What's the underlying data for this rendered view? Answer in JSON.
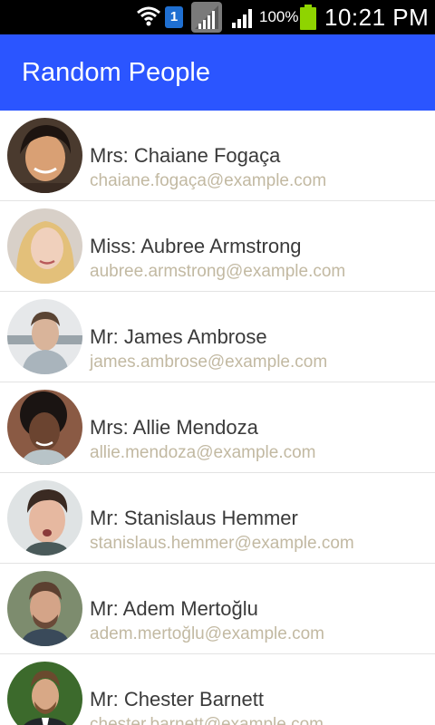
{
  "status_bar": {
    "sim_slot": "1",
    "battery_percent": "100%",
    "time": "10:21 PM",
    "icons": [
      "wifi-icon",
      "sim-icon",
      "signal-empty-icon",
      "signal-icon",
      "battery-icon"
    ],
    "battery_color": "#8fd400"
  },
  "app_bar": {
    "title": "Random People",
    "background_color": "#2b55ff"
  },
  "people": [
    {
      "name": "Mrs: Chaiane Fogaça",
      "email": "chaiane.fogaça@example.com",
      "avatar": "avatar-photo"
    },
    {
      "name": "Miss: Aubree Armstrong",
      "email": "aubree.armstrong@example.com",
      "avatar": "avatar-photo"
    },
    {
      "name": "Mr: James Ambrose",
      "email": "james.ambrose@example.com",
      "avatar": "avatar-photo"
    },
    {
      "name": "Mrs: Allie Mendoza",
      "email": "allie.mendoza@example.com",
      "avatar": "avatar-photo"
    },
    {
      "name": "Mr: Stanislaus Hemmer",
      "email": "stanislaus.hemmer@example.com",
      "avatar": "avatar-photo"
    },
    {
      "name": "Mr: Adem Mertoğlu",
      "email": "adem.mertoğlu@example.com",
      "avatar": "avatar-photo"
    },
    {
      "name": "Mr: Chester Barnett",
      "email": "chester.barnett@example.com",
      "avatar": "avatar-photo"
    }
  ],
  "colors": {
    "name_text": "#3a3a3a",
    "email_text": "#c2b9a2",
    "divider": "#e3e3e3"
  }
}
